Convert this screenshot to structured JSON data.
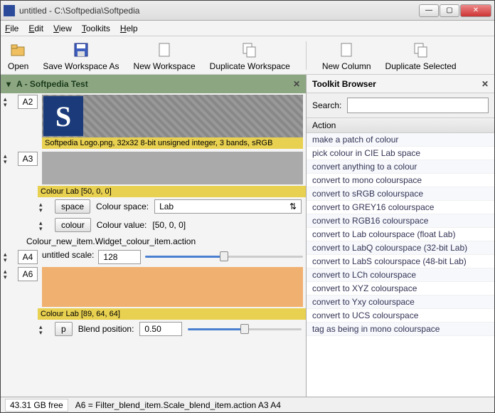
{
  "title": "untitled - C:\\Softpedia\\Softpedia",
  "menu": [
    "File",
    "Edit",
    "View",
    "Toolkits",
    "Help"
  ],
  "toolbar": [
    {
      "id": "open",
      "label": "Open",
      "icon": "folder-open-icon"
    },
    {
      "id": "savews",
      "label": "Save Workspace As",
      "icon": "save-icon"
    },
    {
      "id": "newws",
      "label": "New Workspace",
      "icon": "document-new-icon"
    },
    {
      "id": "dupws",
      "label": "Duplicate Workspace",
      "icon": "duplicate-icon"
    },
    {
      "id": "newcol",
      "label": "New Column",
      "icon": "document-new-icon"
    },
    {
      "id": "dupsel",
      "label": "Duplicate Selected",
      "icon": "duplicate-icon"
    }
  ],
  "leftPanel": {
    "title": "A -  Softpedia Test",
    "a2": {
      "id": "A2",
      "imgInfo": "Softpedia Logo.png, 32x32 8-bit unsigned integer, 3 bands, sRGB",
      "logo": "S"
    },
    "a3": {
      "id": "A3",
      "colourLab": "Colour Lab [50, 0, 0]",
      "spaceBtn": "space",
      "spaceLabel": "Colour space:",
      "spaceVal": "Lab",
      "colourBtn": "colour",
      "colourLabel": "Colour value:",
      "colourVal": "[50, 0, 0]",
      "action": "Colour_new_item.Widget_colour_item.action"
    },
    "a4": {
      "id": "A4",
      "label": "untitled scale:",
      "val": "128",
      "sliderPct": "50%"
    },
    "a6": {
      "id": "A6",
      "colourLab": "Colour Lab [89, 64, 64]",
      "pBtn": "p",
      "pLabel": "Blend position:",
      "pVal": "0.50",
      "sliderPct": "50%"
    }
  },
  "rightPanel": {
    "title": "Toolkit Browser",
    "searchLabel": "Search:",
    "listHeader": "Action",
    "items": [
      "make a patch of colour",
      "pick colour in CIE Lab space",
      "convert anything to a colour",
      "convert to mono colourspace",
      "convert to sRGB colourspace",
      "convert to GREY16 colourspace",
      "convert to RGB16 colourspace",
      "convert to Lab colourspace (float Lab)",
      "convert to LabQ colourspace (32-bit Lab)",
      "convert to LabS colourspace (48-bit Lab)",
      "convert to LCh colourspace",
      "convert to XYZ colourspace",
      "convert to Yxy colourspace",
      "convert to UCS colourspace",
      "tag as being in mono colourspace"
    ]
  },
  "status": {
    "free": "43.31 GB free",
    "expr": "A6 = Filter_blend_item.Scale_blend_item.action A3 A4"
  }
}
